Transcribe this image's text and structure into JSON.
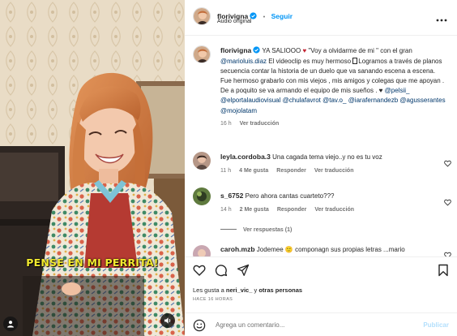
{
  "video": {
    "subtitle": "PENSE EN MI PERRITA!",
    "user_tag_icon": "user-icon",
    "sound_icon": "sound-icon"
  },
  "post": {
    "author": "florivigna",
    "follow_label": "Seguir",
    "audio": "Audio original",
    "more_icon": "more-icon"
  },
  "caption": {
    "author": "florivigna",
    "text_1": " YA SALIOOO ",
    "text_2": " \"Voy a olvidarme de mi \" con el gran ",
    "mention_1": "@marioluis.diaz",
    "text_3": " El videoclip es muy hermoso ",
    "text_4": "Logramos a través de planos secuencia contar la historia de un duelo que va sanando escena a escena. Fue hermoso grabarlo con mis viejos , mis amigos y colegas que me apoyan . De a poquito se va armando el equipo de mis sueños . ♥ ",
    "mentions": [
      "@pelsii_",
      "@elportalaudiovisual",
      "@chulafavrot",
      "@tav.o_",
      "@iarafernandezb",
      "@agusserantes",
      "@mojolatam"
    ],
    "time": "16 h",
    "reply": "Ver traducción"
  },
  "comments": [
    {
      "user": "leyla.cordoba.3",
      "text": "Una cagada tema viejo..y no es tu voz",
      "time": "11 h",
      "likes": "4 Me gusta",
      "reply": "Responder",
      "translate": "Ver traducción"
    },
    {
      "user": "s_6752",
      "text": "Pero ahora cantas cuarteto???",
      "time": "14 h",
      "likes": "2 Me gusta",
      "reply": "Responder",
      "translate": "Ver traducción",
      "view_replies": "Ver respuestas (1)"
    },
    {
      "user": "caroh.mzb",
      "text": "Jodemee",
      "text_2": "componagn sus propias letras ...mario"
    }
  ],
  "actions": {
    "liked_by_prefix": "Les gusta a ",
    "liked_by_user": "neri_vic_",
    "liked_by_suffix": " y ",
    "liked_by_others": "otras personas",
    "time_ago": "HACE 16 HORAS",
    "comment_placeholder": "Agrega un comentario...",
    "publish_label": "Publicar"
  },
  "colors": {
    "accent": "#0095f6",
    "link": "#00376b",
    "subtitle": "#f2ea2e",
    "muted": "#737373"
  }
}
